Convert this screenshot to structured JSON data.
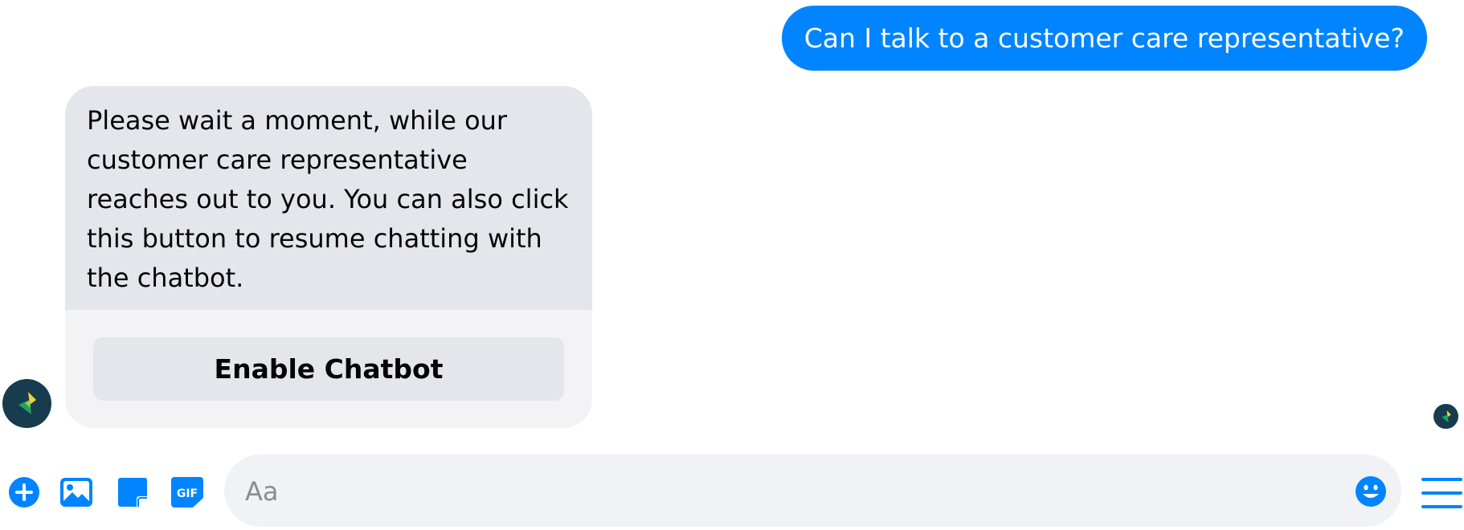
{
  "conversation": {
    "outgoing_message": "Can I talk to a customer care representative?",
    "incoming_message": "Please wait a moment, while our customer care representative reaches out to you. You can also click this button to resume chatting with the chatbot.",
    "incoming_button_label": "Enable Chatbot"
  },
  "composer": {
    "placeholder": "Aa",
    "icons": [
      "plus-icon",
      "image-icon",
      "sticker-icon",
      "gif-icon",
      "emoji-icon",
      "menu-icon"
    ],
    "gif_label": "GIF"
  },
  "colors": {
    "accent": "#0084ff",
    "incoming_bubble": "#e4e6eb",
    "avatar_bg": "#173c4e",
    "avatar_green": "#1fa463",
    "avatar_yellow": "#f4d03f"
  }
}
